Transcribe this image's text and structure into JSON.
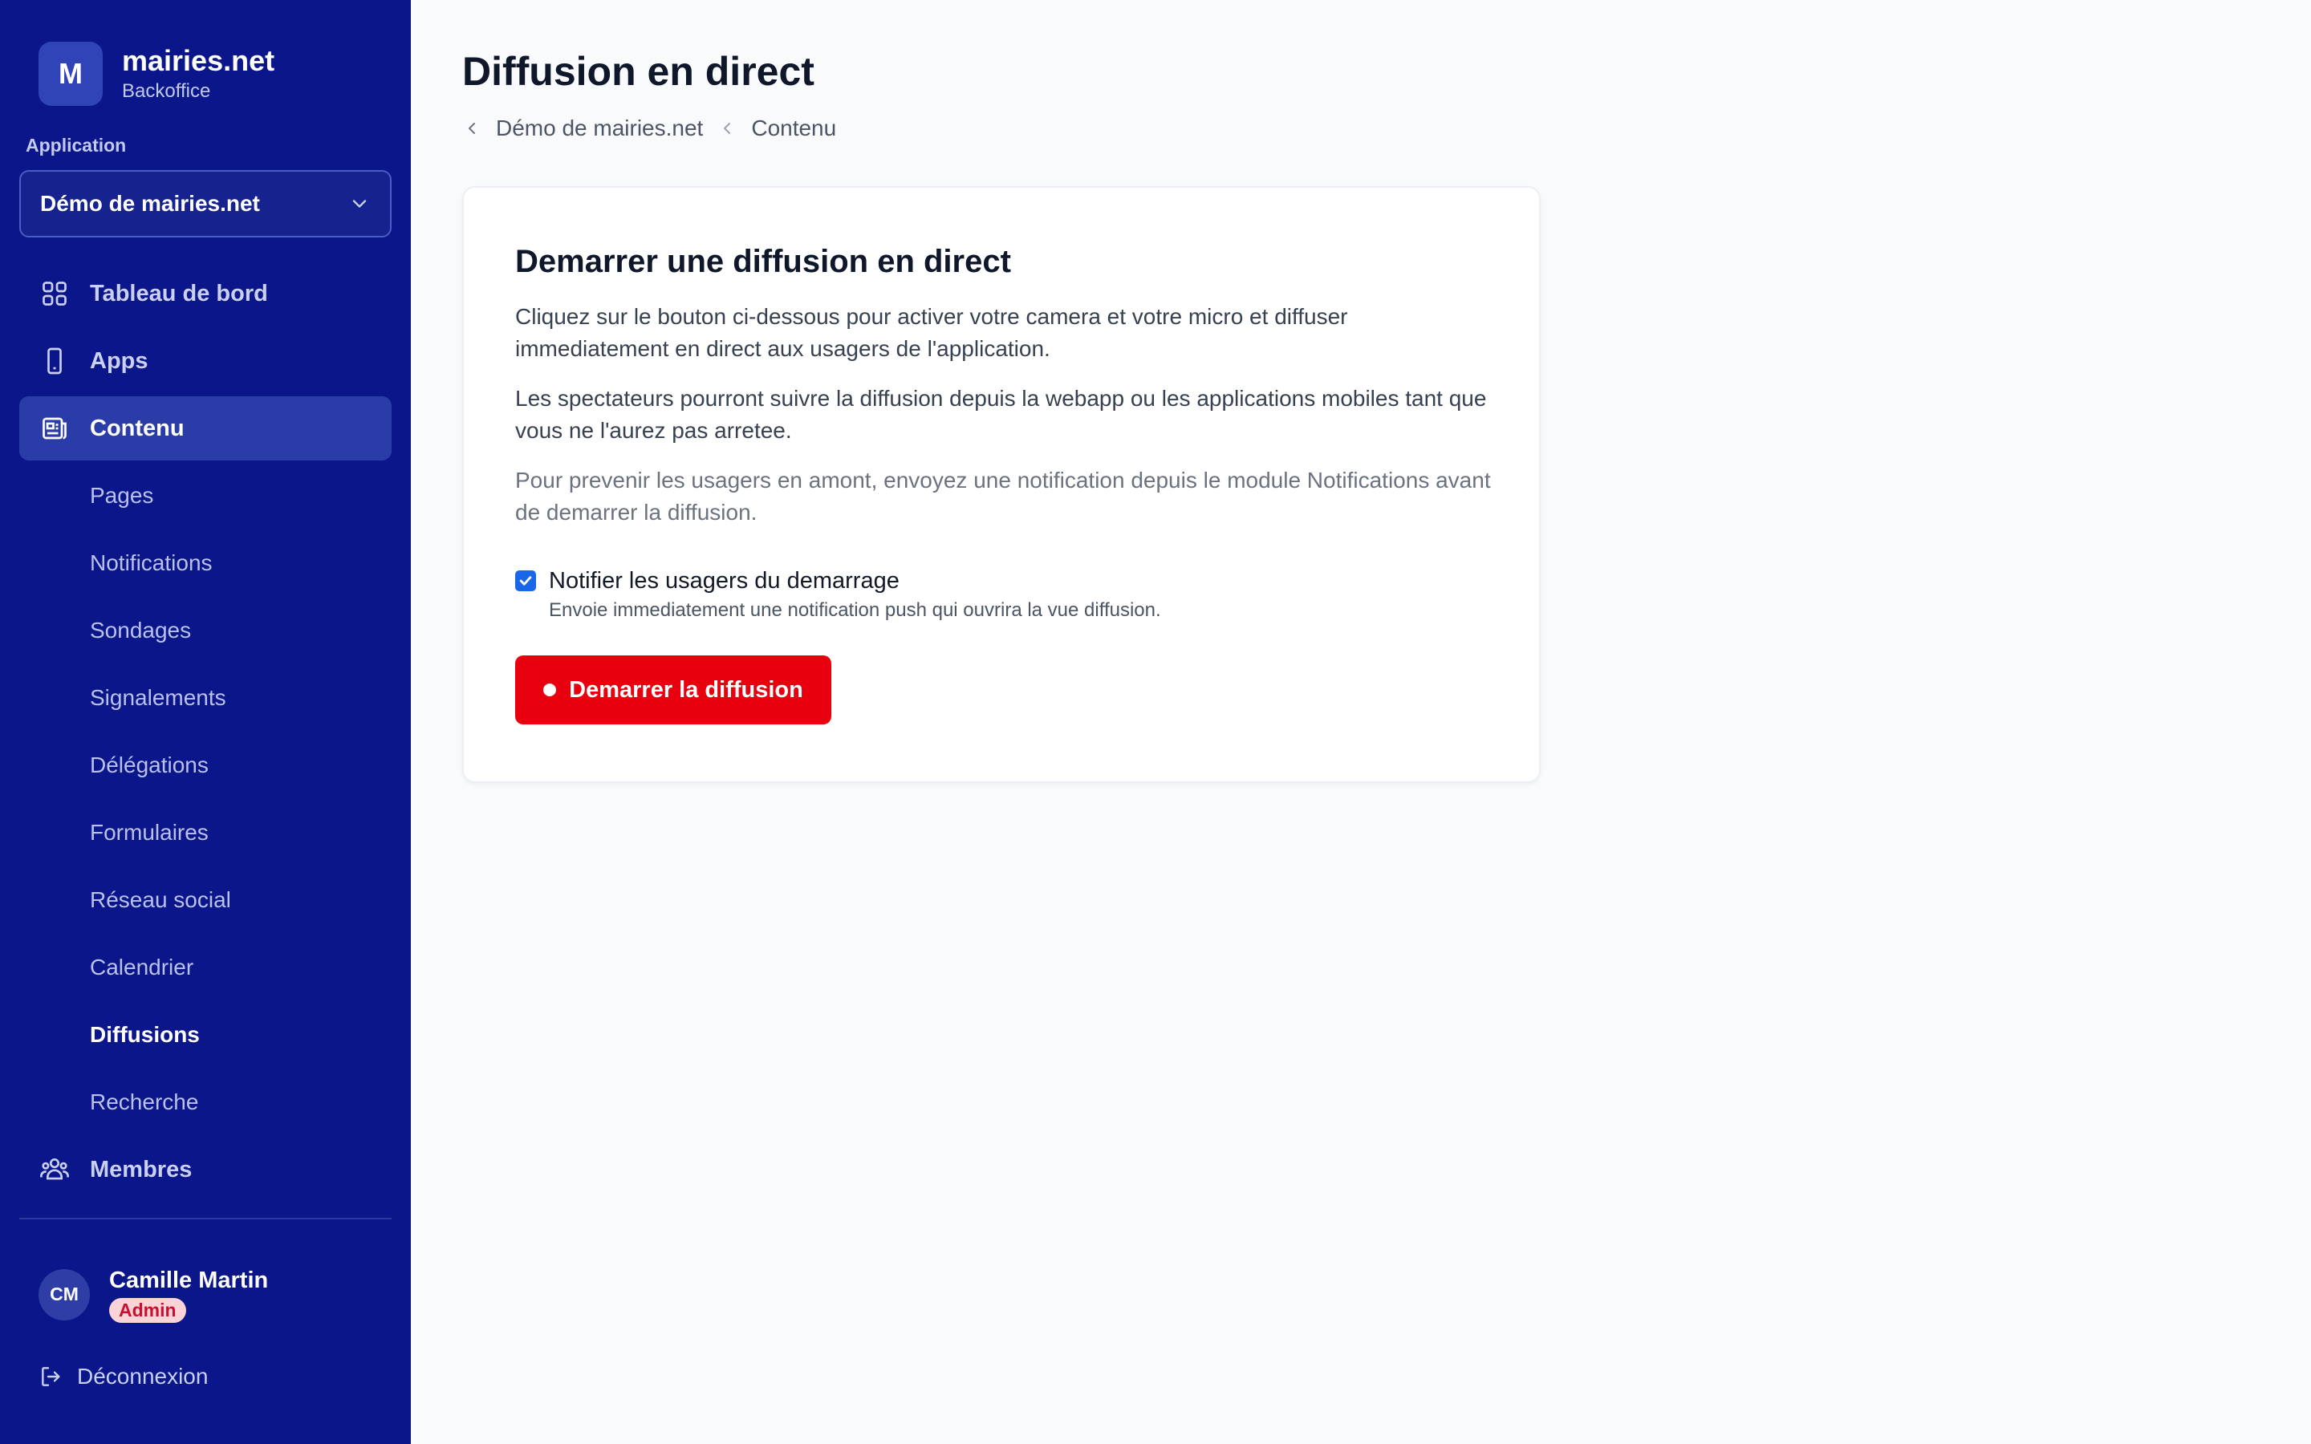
{
  "brand": {
    "logo_letter": "M",
    "name": "mairies.net",
    "subtitle": "Backoffice"
  },
  "app_selector": {
    "label": "Application",
    "value": "Démo de mairies.net"
  },
  "nav": {
    "dashboard": "Tableau de bord",
    "apps": "Apps",
    "content": "Contenu",
    "content_sub": [
      "Pages",
      "Notifications",
      "Sondages",
      "Signalements",
      "Délégations",
      "Formulaires",
      "Réseau social",
      "Calendrier",
      "Diffusions",
      "Recherche"
    ],
    "members": "Membres"
  },
  "user": {
    "initials": "CM",
    "name": "Camille Martin",
    "role": "Admin"
  },
  "logout_label": "Déconnexion",
  "page": {
    "title": "Diffusion en direct",
    "breadcrumb": [
      "Démo de mairies.net",
      "Contenu"
    ]
  },
  "card": {
    "title": "Demarrer une diffusion en direct",
    "para1": "Cliquez sur le bouton ci-dessous pour activer votre camera et votre micro et diffuser immediatement en direct aux usagers de l'application.",
    "para2": "Les spectateurs pourront suivre la diffusion depuis la webapp ou les applications mobiles tant que vous ne l'aurez pas arretee.",
    "para3": "Pour prevenir les usagers en amont, envoyez une notification depuis le module Notifications avant de demarrer la diffusion.",
    "checkbox_label": "Notifier les usagers du demarrage",
    "checkbox_help": "Envoie immediatement une notification push qui ouvrira la vue diffusion.",
    "checkbox_checked": true,
    "button_label": "Demarrer la diffusion"
  },
  "colors": {
    "sidebar": "#0a168a",
    "accent_red": "#e8000f",
    "checkbox": "#1a66e8"
  }
}
